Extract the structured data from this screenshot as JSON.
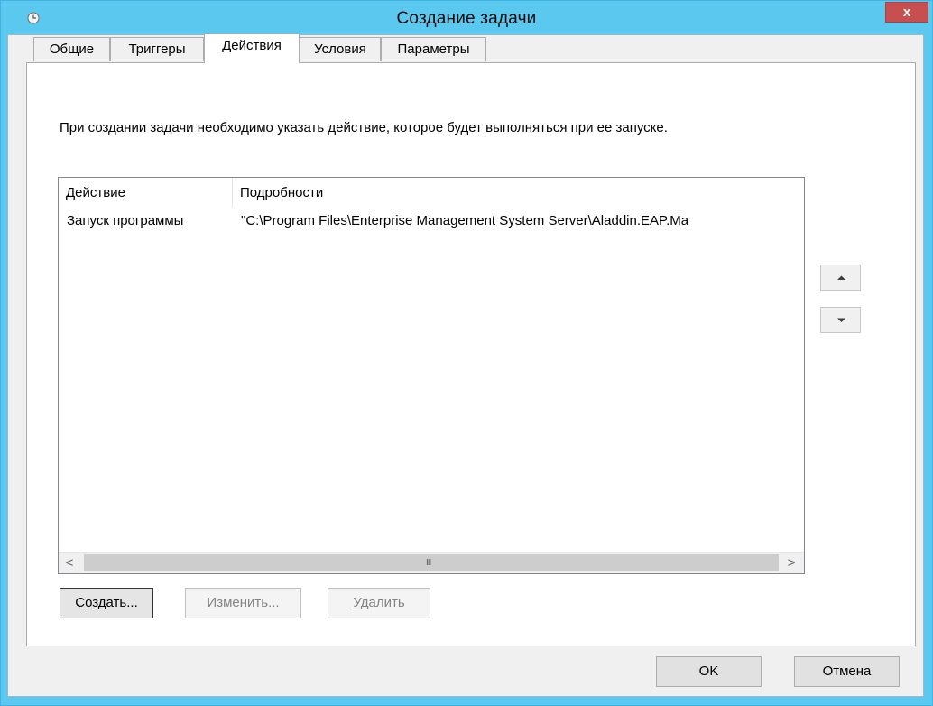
{
  "window": {
    "title": "Создание задачи",
    "close_glyph": "x",
    "icon": "clock-icon"
  },
  "tabs": [
    {
      "label": "Общие",
      "active": false
    },
    {
      "label": "Триггеры",
      "active": false
    },
    {
      "label": "Действия",
      "active": true
    },
    {
      "label": "Условия",
      "active": false
    },
    {
      "label": "Параметры",
      "active": false
    }
  ],
  "actions_tab": {
    "description": "При создании задачи необходимо указать действие, которое будет выполняться при ее запуске.",
    "columns": [
      "Действие",
      "Подробности"
    ],
    "rows": [
      {
        "action": "Запуск программы",
        "details": "\"C:\\Program Files\\Enterprise Management System Server\\Aladdin.EAP.Ma"
      }
    ],
    "scroll_left_glyph": "<",
    "scroll_right_glyph": ">",
    "scroll_grip_glyph": "III",
    "create_pre": "С",
    "create_ul": "о",
    "create_post": "здать...",
    "edit_ul": "И",
    "edit_post": "зменить...",
    "delete_ul": "У",
    "delete_post": "далить"
  },
  "footer": {
    "ok_label": "OK",
    "cancel_label": "Отмена"
  },
  "colors": {
    "titlebar": "#5bc8ef",
    "close": "#c74f50"
  }
}
